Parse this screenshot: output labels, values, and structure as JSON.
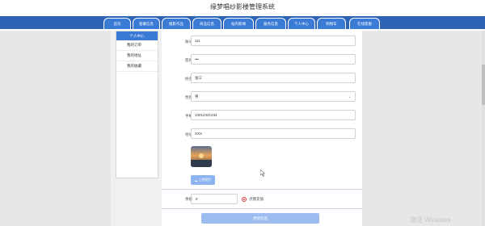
{
  "header": {
    "title": "缘梦唱纱影楼管理系统"
  },
  "nav": {
    "items": [
      {
        "label": "首页"
      },
      {
        "label": "套餐信息"
      },
      {
        "label": "摄影作品"
      },
      {
        "label": "商品信息"
      },
      {
        "label": "站内新闻"
      },
      {
        "label": "服务信息"
      },
      {
        "label": "个人中心"
      },
      {
        "label": "购物车"
      },
      {
        "label": "在线客服"
      }
    ]
  },
  "sidebar": {
    "title": "个人中心",
    "items": [
      {
        "label": "我的订单"
      },
      {
        "label": "我的地址"
      },
      {
        "label": "我的收藏"
      }
    ]
  },
  "form": {
    "account_label": "账号",
    "account_value": "111",
    "password_label": "密码",
    "password_value": "•••",
    "name_label": "姓名",
    "name_value": "张三",
    "gender_label": "性别",
    "gender_value": "男",
    "phone_label": "手机",
    "phone_value": "13012341234",
    "address_label": "地址",
    "address_value": "XXX",
    "upload_label": "上传图片",
    "balance_label": "余额",
    "balance_value": "0",
    "recharge_label": "点我充值",
    "update_button": "更新信息"
  },
  "watermark": "激活 Windows",
  "colors": {
    "nav_band": "#2e62b5",
    "nav_tab": "#3a7bd5",
    "button": "#9dbdf0",
    "radio_accent": "#e0383e"
  },
  "icons": {
    "upload": "upload-icon",
    "dropdown": "chevron-down-icon",
    "cursor": "mouse-pointer-icon"
  }
}
